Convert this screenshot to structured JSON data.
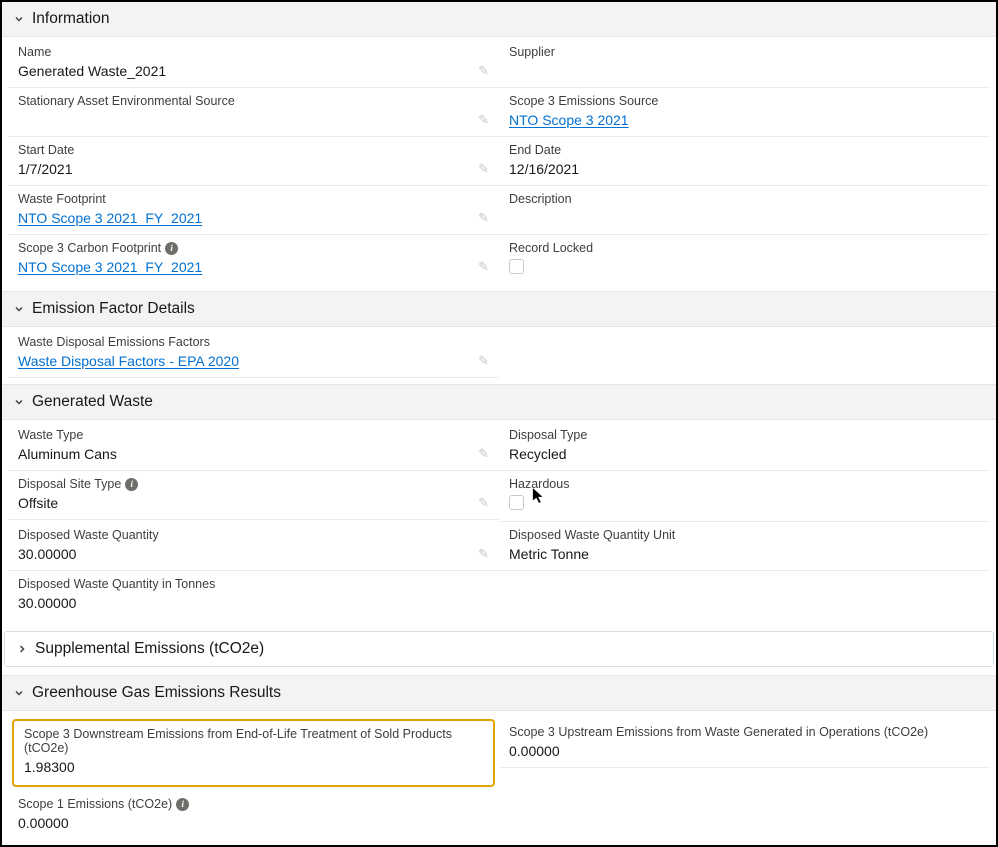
{
  "sections": {
    "information": {
      "title": "Information"
    },
    "emissionFactorDetails": {
      "title": "Emission Factor Details"
    },
    "generatedWaste": {
      "title": "Generated Waste"
    },
    "supplementalEmissions": {
      "title": "Supplemental Emissions (tCO2e)"
    },
    "ghgResults": {
      "title": "Greenhouse Gas Emissions Results"
    }
  },
  "information": {
    "name": {
      "label": "Name",
      "value": "Generated Waste_2021"
    },
    "supplier": {
      "label": "Supplier",
      "value": ""
    },
    "stationaryAsset": {
      "label": "Stationary Asset Environmental Source",
      "value": ""
    },
    "scope3Source": {
      "label": "Scope 3 Emissions Source",
      "value": "NTO Scope 3 2021"
    },
    "startDate": {
      "label": "Start Date",
      "value": "1/7/2021"
    },
    "endDate": {
      "label": "End Date",
      "value": "12/16/2021"
    },
    "wasteFootprint": {
      "label": "Waste Footprint",
      "value": "NTO Scope 3 2021_FY_2021"
    },
    "description": {
      "label": "Description",
      "value": ""
    },
    "scope3CarbonFootprint": {
      "label": "Scope 3 Carbon Footprint",
      "value": "NTO Scope 3 2021_FY_2021"
    },
    "recordLocked": {
      "label": "Record Locked"
    }
  },
  "emissionFactorDetails": {
    "wasteDisposalFactors": {
      "label": "Waste Disposal Emissions Factors",
      "value": "Waste Disposal Factors - EPA 2020"
    }
  },
  "generatedWaste": {
    "wasteType": {
      "label": "Waste Type",
      "value": "Aluminum Cans"
    },
    "disposalType": {
      "label": "Disposal Type",
      "value": "Recycled"
    },
    "disposalSiteType": {
      "label": "Disposal Site Type",
      "value": "Offsite"
    },
    "hazardous": {
      "label": "Hazardous"
    },
    "disposedQty": {
      "label": "Disposed Waste Quantity",
      "value": "30.00000"
    },
    "disposedQtyUnit": {
      "label": "Disposed Waste Quantity Unit",
      "value": "Metric Tonne"
    },
    "disposedQtyTonnes": {
      "label": "Disposed Waste Quantity in Tonnes",
      "value": "30.00000"
    }
  },
  "ghgResults": {
    "scope3Downstream": {
      "label": "Scope 3 Downstream Emissions from End-of-Life Treatment of Sold Products (tCO2e)",
      "value": "1.98300"
    },
    "scope3Upstream": {
      "label": "Scope 3 Upstream Emissions from Waste Generated in Operations (tCO2e)",
      "value": "0.00000"
    },
    "scope1": {
      "label": "Scope 1 Emissions (tCO2e)",
      "value": "0.00000"
    }
  }
}
